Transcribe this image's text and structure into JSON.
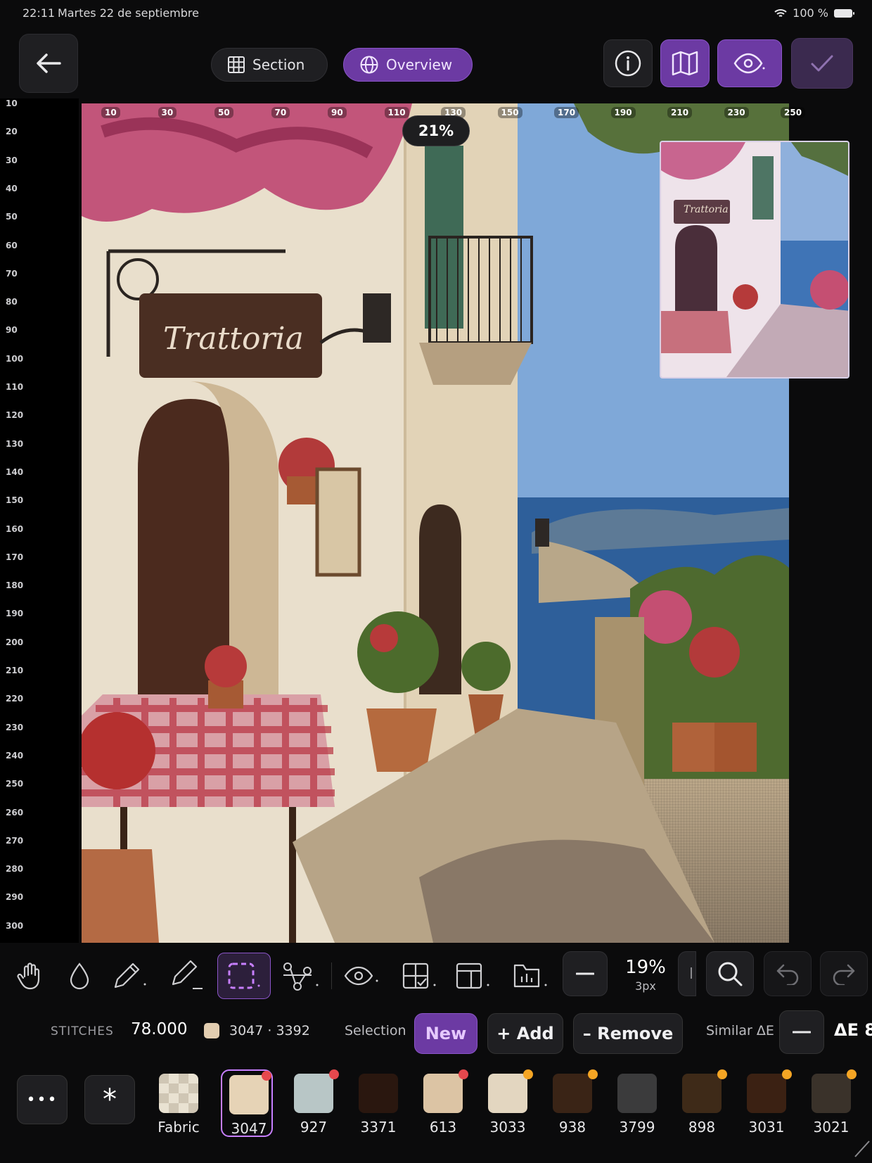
{
  "status_bar": {
    "time": "22:11",
    "date": "Martes 22 de septiembre",
    "battery": "100 %"
  },
  "header": {
    "section_label": "Section",
    "overview_label": "Overview"
  },
  "canvas": {
    "zoom_badge": "21%",
    "sign_text": "Trattoria",
    "ruler_top": [
      "10",
      "30",
      "50",
      "70",
      "90",
      "110",
      "130",
      "150",
      "170",
      "190",
      "210",
      "230",
      "250"
    ],
    "ruler_left": [
      "10",
      "20",
      "30",
      "40",
      "50",
      "60",
      "70",
      "80",
      "90",
      "100",
      "110",
      "120",
      "130",
      "140",
      "150",
      "160",
      "170",
      "180",
      "190",
      "200",
      "210",
      "220",
      "230",
      "240",
      "250",
      "260",
      "270",
      "280",
      "290",
      "300"
    ]
  },
  "tools": {
    "zoom_pct": "19%",
    "zoom_px": "3px"
  },
  "info_row": {
    "stitches_label": "STITCHES",
    "stitches_value": "78.000",
    "color_codes": "3047 · 3392",
    "selection_label": "Selection",
    "new_label": "New",
    "add_label": "+ Add",
    "remove_label": "– Remove",
    "similar_label": "Similar ΔE",
    "delta_label": "ΔE 8"
  },
  "palette": {
    "more_label": "•••",
    "wildcard_label": "*",
    "swatches": [
      {
        "code": "Fabric",
        "color": "#ece5d6",
        "dot": ""
      },
      {
        "code": "3047",
        "color": "#e6d3b6",
        "dot": "#e5484d"
      },
      {
        "code": "927",
        "color": "#b8c6c6",
        "dot": "#e5484d"
      },
      {
        "code": "3371",
        "color": "#2a170f",
        "dot": ""
      },
      {
        "code": "613",
        "color": "#dcc4a4",
        "dot": "#e5484d"
      },
      {
        "code": "3033",
        "color": "#e3d6c0",
        "dot": "#f5a524"
      },
      {
        "code": "938",
        "color": "#3a2416",
        "dot": "#f5a524"
      },
      {
        "code": "3799",
        "color": "#3b3b3c",
        "dot": ""
      },
      {
        "code": "898",
        "color": "#3e2a18",
        "dot": "#f5a524"
      },
      {
        "code": "3031",
        "color": "#3b2113",
        "dot": "#f5a524"
      },
      {
        "code": "3021",
        "color": "#3a322a",
        "dot": "#f5a524"
      }
    ]
  },
  "colors": {
    "accent": "#6c3aa3",
    "accent_border": "#8b55c8",
    "background": "#0b0b0c"
  }
}
